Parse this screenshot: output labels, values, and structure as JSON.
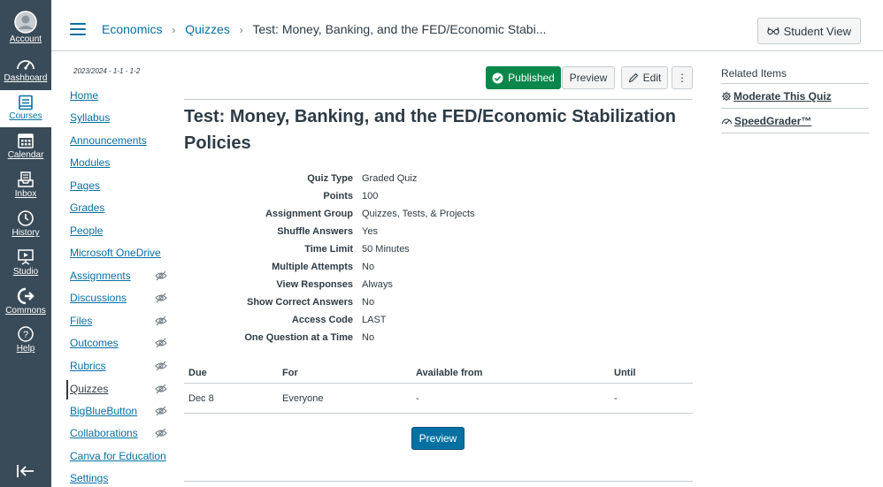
{
  "global_nav": {
    "items": [
      {
        "label": "Account"
      },
      {
        "label": "Dashboard"
      },
      {
        "label": "Courses"
      },
      {
        "label": "Calendar"
      },
      {
        "label": "Inbox"
      },
      {
        "label": "History"
      },
      {
        "label": "Studio"
      },
      {
        "label": "Commons"
      },
      {
        "label": "Help"
      }
    ],
    "active": "Courses",
    "active_color": "#0770a3",
    "bg_color": "#394b58"
  },
  "breadcrumb": {
    "items": [
      "Economics",
      "Quizzes",
      "Test: Money, Banking, and the FED/Economic Stabi..."
    ]
  },
  "header": {
    "student_view_label": "Student View"
  },
  "course_nav": {
    "term": "2023/2024 - 1-1 - 1-2",
    "items": [
      {
        "label": "Home",
        "hidden": false
      },
      {
        "label": "Syllabus",
        "hidden": false
      },
      {
        "label": "Announcements",
        "hidden": false
      },
      {
        "label": "Modules",
        "hidden": false
      },
      {
        "label": "Pages",
        "hidden": false
      },
      {
        "label": "Grades",
        "hidden": false
      },
      {
        "label": "People",
        "hidden": false
      },
      {
        "label": "Microsoft OneDrive",
        "hidden": false
      },
      {
        "label": "Assignments",
        "hidden": true
      },
      {
        "label": "Discussions",
        "hidden": true
      },
      {
        "label": "Files",
        "hidden": true
      },
      {
        "label": "Outcomes",
        "hidden": true
      },
      {
        "label": "Rubrics",
        "hidden": true
      },
      {
        "label": "Quizzes",
        "hidden": true,
        "active": true
      },
      {
        "label": "BigBlueButton",
        "hidden": true
      },
      {
        "label": "Collaborations",
        "hidden": true
      },
      {
        "label": "Canva for Education",
        "hidden": false
      },
      {
        "label": "Settings",
        "hidden": false
      }
    ]
  },
  "toolbar": {
    "published_label": "Published",
    "published_color": "#0b874b",
    "preview_label": "Preview",
    "edit_label": "Edit",
    "more_label": "⋮"
  },
  "quiz": {
    "title": "Test: Money, Banking, and the FED/Economic Stabilization Policies",
    "details": [
      {
        "key": "Quiz Type",
        "value": "Graded Quiz"
      },
      {
        "key": "Points",
        "value": "100"
      },
      {
        "key": "Assignment Group",
        "value": "Quizzes, Tests, & Projects"
      },
      {
        "key": "Shuffle Answers",
        "value": "Yes"
      },
      {
        "key": "Time Limit",
        "value": "50 Minutes"
      },
      {
        "key": "Multiple Attempts",
        "value": "No"
      },
      {
        "key": "View Responses",
        "value": "Always"
      },
      {
        "key": "Show Correct Answers",
        "value": "No"
      },
      {
        "key": "Access Code",
        "value": "LAST"
      },
      {
        "key": "One Question at a Time",
        "value": "No"
      }
    ]
  },
  "due_table": {
    "headers": [
      "Due",
      "For",
      "Available from",
      "Until"
    ],
    "rows": [
      [
        "Dec 8",
        "Everyone",
        "-",
        "-"
      ]
    ]
  },
  "preview_button_label": "Preview",
  "preview_button_color": "#0770a3",
  "related": {
    "heading": "Related Items",
    "items": [
      {
        "label": "Moderate This Quiz",
        "icon": "gear-icon"
      },
      {
        "label": "SpeedGrader™",
        "icon": "speedgrader-icon"
      }
    ]
  }
}
